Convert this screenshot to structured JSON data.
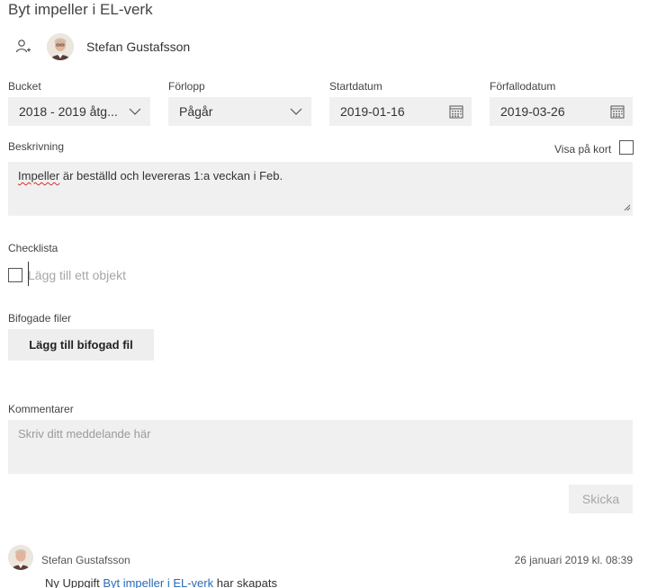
{
  "task": {
    "title": "Byt impeller i EL-verk",
    "assignee": {
      "name": "Stefan Gustafsson",
      "add_icon": "add-person-icon"
    }
  },
  "fields": {
    "bucket": {
      "label": "Bucket",
      "value": "2018 - 2019 åtg...",
      "icon": "chevron-down-icon"
    },
    "progress": {
      "label": "Förlopp",
      "value": "Pågår",
      "icon": "chevron-down-icon"
    },
    "start_date": {
      "label": "Startdatum",
      "value": "2019-01-16",
      "icon": "calendar-icon"
    },
    "due_date": {
      "label": "Förfallodatum",
      "value": "2019-03-26",
      "icon": "calendar-icon"
    }
  },
  "description": {
    "label": "Beskrivning",
    "show_on_card_label": "Visa på kort",
    "show_on_card_checked": false,
    "text_misspelled": "Impeller",
    "text_rest": " är beställd och levereras 1:a veckan i Feb."
  },
  "checklist": {
    "label": "Checklista",
    "placeholder": "Lägg till ett objekt"
  },
  "attachments": {
    "label": "Bifogade filer",
    "add_button": "Lägg till bifogad fil"
  },
  "comments": {
    "label": "Kommentarer",
    "placeholder": "Skriv ditt meddelande här",
    "send_button": "Skicka",
    "items": [
      {
        "author": "Stefan Gustafsson",
        "timestamp": "26 januari 2019 kl. 08:39",
        "prefix": "Ny Uppgift ",
        "link_text": "Byt impeller i EL-verk",
        "suffix": " har skapats"
      }
    ]
  },
  "colors": {
    "field_bg": "#f0f0f0",
    "link": "#2a6bb8",
    "placeholder": "#a6a6a6"
  }
}
